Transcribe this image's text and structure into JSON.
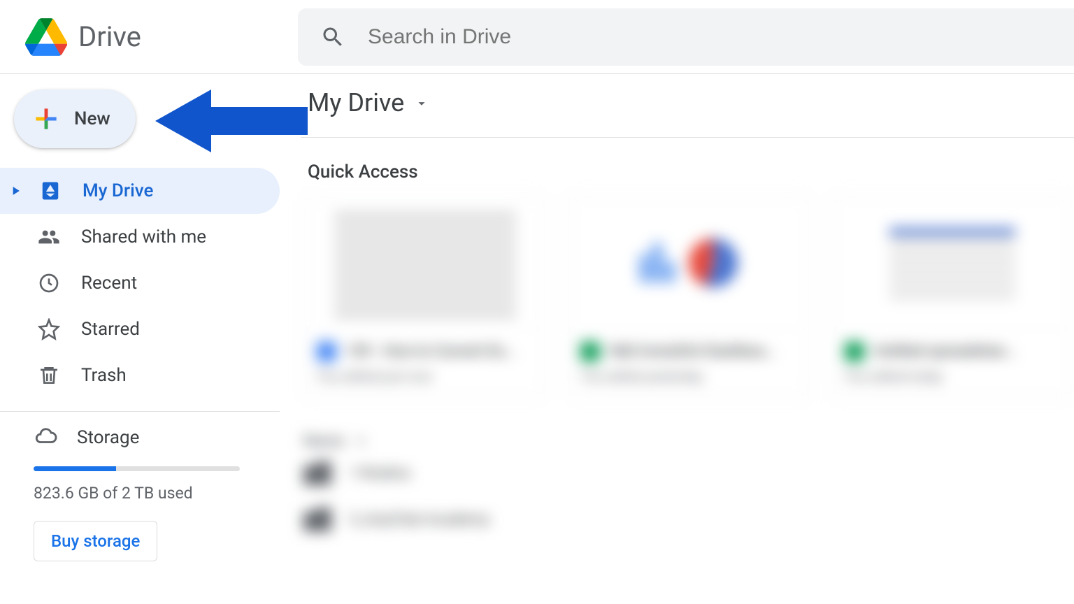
{
  "header": {
    "app_name": "Drive",
    "search_placeholder": "Search in Drive"
  },
  "sidebar": {
    "new_label": "New",
    "items": [
      {
        "label": "My Drive",
        "icon": "mydrive-icon",
        "active": true,
        "expandable": true
      },
      {
        "label": "Shared with me",
        "icon": "shared-icon"
      },
      {
        "label": "Recent",
        "icon": "recent-icon"
      },
      {
        "label": "Starred",
        "icon": "starred-icon"
      },
      {
        "label": "Trash",
        "icon": "trash-icon"
      }
    ],
    "storage": {
      "label": "Storage",
      "used_text": "823.6 GB of 2 TB used",
      "percent": 40,
      "buy_label": "Buy storage"
    }
  },
  "main": {
    "breadcrumb_title": "My Drive",
    "quick_access_label": "Quick Access",
    "quick_access": [
      {
        "title": "109 - How to Convert Ex...",
        "subtitle": "You edited just now",
        "type": "docs"
      },
      {
        "title": "Náš Investiční Dashboa...",
        "subtitle": "You edited yesterday",
        "type": "sheets"
      },
      {
        "title": "Untitled spreadshee...",
        "subtitle": "You edited today",
        "type": "sheets"
      }
    ],
    "column_header": "Name",
    "folders": [
      {
        "name": "1-Rodina"
      },
      {
        "name": "3_AnyClub Academy"
      }
    ]
  },
  "annotation": {
    "arrow_points_to": "new-button"
  }
}
